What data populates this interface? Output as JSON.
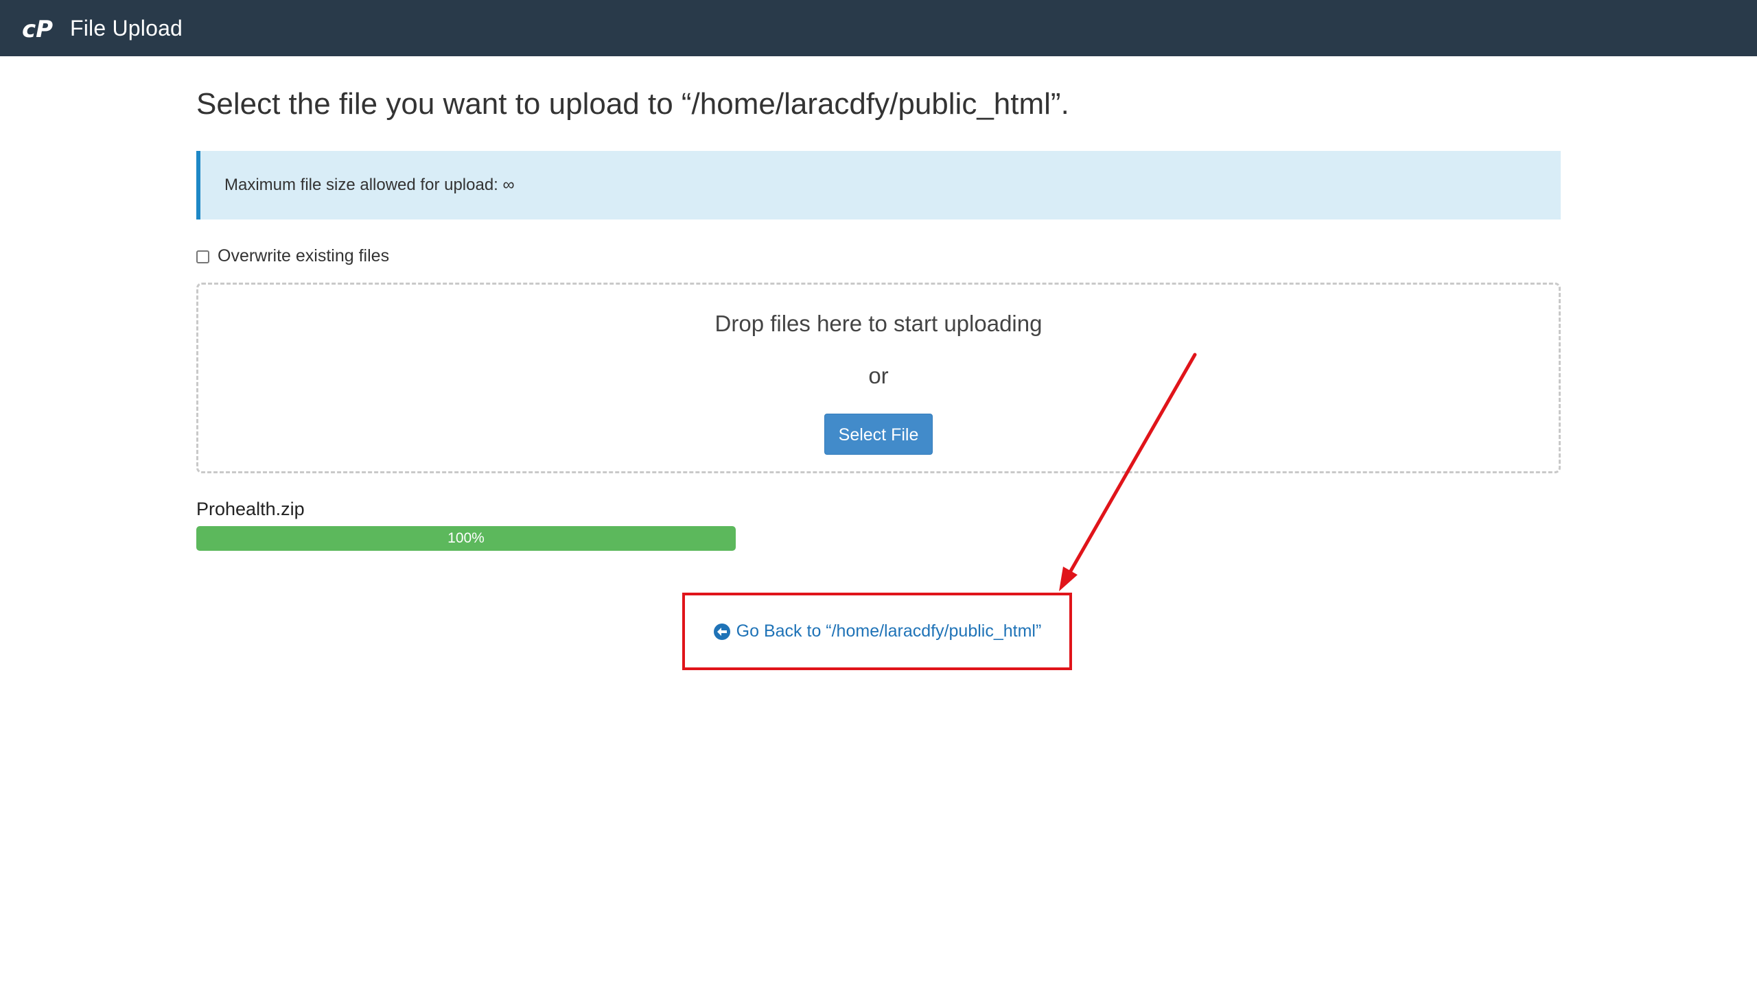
{
  "header": {
    "logo": "cpanel-logo-icon",
    "title": "File Upload"
  },
  "main": {
    "heading": "Select the file you want to upload to “/home/laracdfy/public_html”.",
    "info": "Maximum file size allowed for upload: ∞",
    "overwrite_label": "Overwrite existing files",
    "overwrite_checked": false,
    "dropzone": {
      "drop_text": "Drop files here to start uploading",
      "or_text": "or",
      "select_button": "Select File"
    },
    "upload": {
      "file_name": "Prohealth.zip",
      "progress_label": "100%",
      "progress_value": 1.0
    },
    "go_back": {
      "icon": "circle-arrow-left-icon",
      "label": "Go Back to “/home/laracdfy/public_html”"
    }
  },
  "annotation": {
    "color": "#e0141a"
  },
  "colors": {
    "header_bg": "#293a4a",
    "info_bg": "#d9edf7",
    "info_border": "#1e88c6",
    "button": "#428bca",
    "progress": "#5cb85c",
    "link": "#1f73b7"
  }
}
